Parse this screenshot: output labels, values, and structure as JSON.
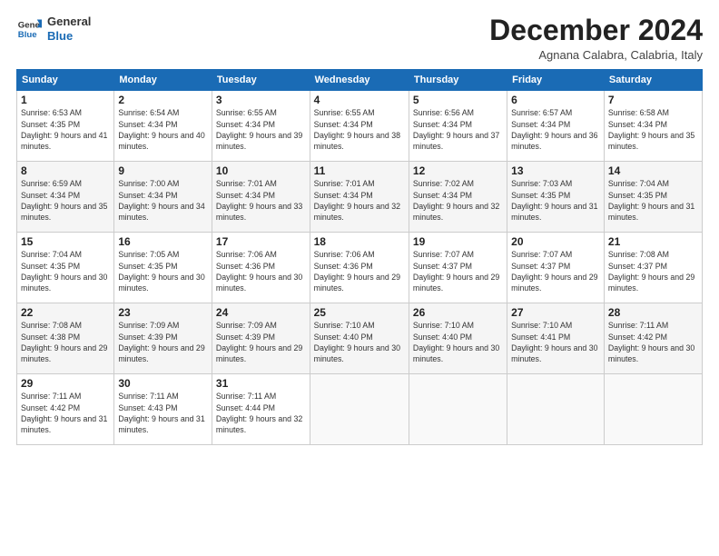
{
  "logo": {
    "line1": "General",
    "line2": "Blue"
  },
  "title": "December 2024",
  "location": "Agnana Calabra, Calabria, Italy",
  "weekdays": [
    "Sunday",
    "Monday",
    "Tuesday",
    "Wednesday",
    "Thursday",
    "Friday",
    "Saturday"
  ],
  "weeks": [
    [
      {
        "day": "1",
        "sunrise": "6:53 AM",
        "sunset": "4:35 PM",
        "daylight": "9 hours and 41 minutes."
      },
      {
        "day": "2",
        "sunrise": "6:54 AM",
        "sunset": "4:34 PM",
        "daylight": "9 hours and 40 minutes."
      },
      {
        "day": "3",
        "sunrise": "6:55 AM",
        "sunset": "4:34 PM",
        "daylight": "9 hours and 39 minutes."
      },
      {
        "day": "4",
        "sunrise": "6:55 AM",
        "sunset": "4:34 PM",
        "daylight": "9 hours and 38 minutes."
      },
      {
        "day": "5",
        "sunrise": "6:56 AM",
        "sunset": "4:34 PM",
        "daylight": "9 hours and 37 minutes."
      },
      {
        "day": "6",
        "sunrise": "6:57 AM",
        "sunset": "4:34 PM",
        "daylight": "9 hours and 36 minutes."
      },
      {
        "day": "7",
        "sunrise": "6:58 AM",
        "sunset": "4:34 PM",
        "daylight": "9 hours and 35 minutes."
      }
    ],
    [
      {
        "day": "8",
        "sunrise": "6:59 AM",
        "sunset": "4:34 PM",
        "daylight": "9 hours and 35 minutes."
      },
      {
        "day": "9",
        "sunrise": "7:00 AM",
        "sunset": "4:34 PM",
        "daylight": "9 hours and 34 minutes."
      },
      {
        "day": "10",
        "sunrise": "7:01 AM",
        "sunset": "4:34 PM",
        "daylight": "9 hours and 33 minutes."
      },
      {
        "day": "11",
        "sunrise": "7:01 AM",
        "sunset": "4:34 PM",
        "daylight": "9 hours and 32 minutes."
      },
      {
        "day": "12",
        "sunrise": "7:02 AM",
        "sunset": "4:34 PM",
        "daylight": "9 hours and 32 minutes."
      },
      {
        "day": "13",
        "sunrise": "7:03 AM",
        "sunset": "4:35 PM",
        "daylight": "9 hours and 31 minutes."
      },
      {
        "day": "14",
        "sunrise": "7:04 AM",
        "sunset": "4:35 PM",
        "daylight": "9 hours and 31 minutes."
      }
    ],
    [
      {
        "day": "15",
        "sunrise": "7:04 AM",
        "sunset": "4:35 PM",
        "daylight": "9 hours and 30 minutes."
      },
      {
        "day": "16",
        "sunrise": "7:05 AM",
        "sunset": "4:35 PM",
        "daylight": "9 hours and 30 minutes."
      },
      {
        "day": "17",
        "sunrise": "7:06 AM",
        "sunset": "4:36 PM",
        "daylight": "9 hours and 30 minutes."
      },
      {
        "day": "18",
        "sunrise": "7:06 AM",
        "sunset": "4:36 PM",
        "daylight": "9 hours and 29 minutes."
      },
      {
        "day": "19",
        "sunrise": "7:07 AM",
        "sunset": "4:37 PM",
        "daylight": "9 hours and 29 minutes."
      },
      {
        "day": "20",
        "sunrise": "7:07 AM",
        "sunset": "4:37 PM",
        "daylight": "9 hours and 29 minutes."
      },
      {
        "day": "21",
        "sunrise": "7:08 AM",
        "sunset": "4:37 PM",
        "daylight": "9 hours and 29 minutes."
      }
    ],
    [
      {
        "day": "22",
        "sunrise": "7:08 AM",
        "sunset": "4:38 PM",
        "daylight": "9 hours and 29 minutes."
      },
      {
        "day": "23",
        "sunrise": "7:09 AM",
        "sunset": "4:39 PM",
        "daylight": "9 hours and 29 minutes."
      },
      {
        "day": "24",
        "sunrise": "7:09 AM",
        "sunset": "4:39 PM",
        "daylight": "9 hours and 29 minutes."
      },
      {
        "day": "25",
        "sunrise": "7:10 AM",
        "sunset": "4:40 PM",
        "daylight": "9 hours and 30 minutes."
      },
      {
        "day": "26",
        "sunrise": "7:10 AM",
        "sunset": "4:40 PM",
        "daylight": "9 hours and 30 minutes."
      },
      {
        "day": "27",
        "sunrise": "7:10 AM",
        "sunset": "4:41 PM",
        "daylight": "9 hours and 30 minutes."
      },
      {
        "day": "28",
        "sunrise": "7:11 AM",
        "sunset": "4:42 PM",
        "daylight": "9 hours and 30 minutes."
      }
    ],
    [
      {
        "day": "29",
        "sunrise": "7:11 AM",
        "sunset": "4:42 PM",
        "daylight": "9 hours and 31 minutes."
      },
      {
        "day": "30",
        "sunrise": "7:11 AM",
        "sunset": "4:43 PM",
        "daylight": "9 hours and 31 minutes."
      },
      {
        "day": "31",
        "sunrise": "7:11 AM",
        "sunset": "4:44 PM",
        "daylight": "9 hours and 32 minutes."
      },
      null,
      null,
      null,
      null
    ]
  ]
}
